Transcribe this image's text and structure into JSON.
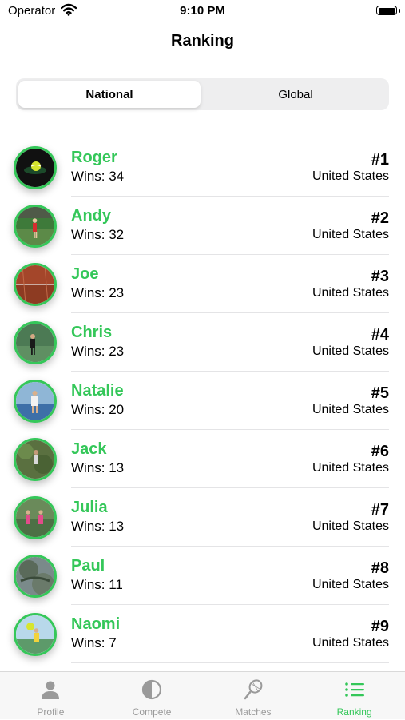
{
  "status_bar": {
    "carrier": "Operator",
    "time": "9:10 PM"
  },
  "nav": {
    "title": "Ranking"
  },
  "segments": {
    "national": "National",
    "global": "Global",
    "selected": "National"
  },
  "players": [
    {
      "name": "Roger",
      "wins": "Wins: 34",
      "rank": "#1",
      "country": "United States"
    },
    {
      "name": "Andy",
      "wins": "Wins: 32",
      "rank": "#2",
      "country": "United States"
    },
    {
      "name": "Joe",
      "wins": "Wins: 23",
      "rank": "#3",
      "country": "United States"
    },
    {
      "name": "Chris",
      "wins": "Wins: 23",
      "rank": "#4",
      "country": "United States"
    },
    {
      "name": "Natalie",
      "wins": "Wins: 20",
      "rank": "#5",
      "country": "United States"
    },
    {
      "name": "Jack",
      "wins": "Wins: 13",
      "rank": "#6",
      "country": "United States"
    },
    {
      "name": "Julia",
      "wins": "Wins: 13",
      "rank": "#7",
      "country": "United States"
    },
    {
      "name": "Paul",
      "wins": "Wins: 11",
      "rank": "#8",
      "country": "United States"
    },
    {
      "name": "Naomi",
      "wins": "Wins: 7",
      "rank": "#9",
      "country": "United States"
    }
  ],
  "tabs": [
    {
      "label": "Profile",
      "icon": "person-icon"
    },
    {
      "label": "Compete",
      "icon": "compete-icon"
    },
    {
      "label": "Matches",
      "icon": "tennis-racket-icon"
    },
    {
      "label": "Ranking",
      "icon": "list-icon",
      "active": true
    }
  ],
  "colors": {
    "accent": "#34c759",
    "ring": "#35c759",
    "inactive_tab": "#9a9a9a"
  }
}
